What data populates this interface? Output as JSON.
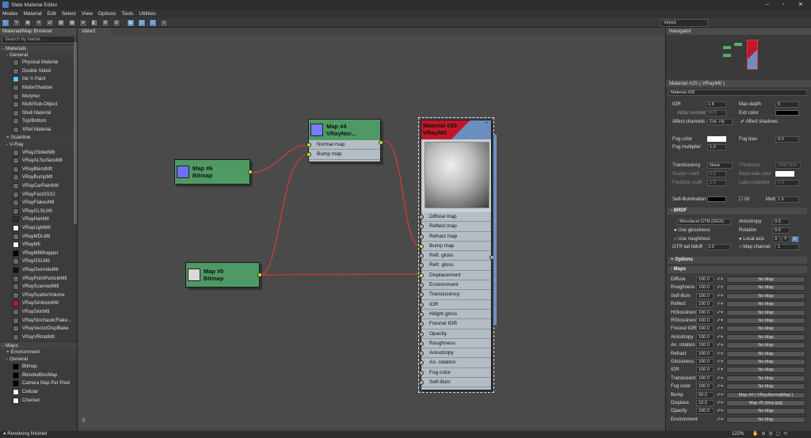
{
  "window": {
    "title": "Slate Material Editor"
  },
  "menu": [
    "Modes",
    "Material",
    "Edit",
    "Select",
    "View",
    "Options",
    "Tools",
    "Utilities"
  ],
  "toolbar": {
    "view_selector": "View1"
  },
  "browser": {
    "title": "Material/Map Browser",
    "search_placeholder": "Search by Name ...",
    "materials_label": "Materials",
    "general_label": "General",
    "general_items": [
      "Physical Material",
      "Double Sided",
      "Ink 'n Paint",
      "Matte/Shadow",
      "Morpher",
      "Multi/Sub-Object",
      "Shell Material",
      "Top/Bottom",
      "XRef Material"
    ],
    "scanline_label": "Scanline",
    "vray_label": "V-Ray",
    "vray_items": [
      "VRay2SidedMtl",
      "VRayALSurfaceMtl",
      "VRayBlendMtl",
      "VRayBumpMtl",
      "VRayCarPaintMtl",
      "VRayFastSSS2",
      "VRayFlakesMtl",
      "VRayGLSLMtl",
      "VRayHairMtl",
      "VRayLightMtl",
      "VRayMDLMtl",
      "VRayMtl",
      "VRayMtlWrapper",
      "VRayOSLMtl",
      "VRayOverrideMtl",
      "VRayPointParticleMtl",
      "VRayScannedMtl",
      "VRayScatterVolume",
      "VRaySimbiontMtl",
      "VRaySkinMtl",
      "VRayStochasticFlake...",
      "VRayVectorDisplBake",
      "VRayVRmatMtl"
    ],
    "maps_label": "Maps",
    "environment_label": "Environment",
    "maps_general_label": "General",
    "maps_items": [
      "Bitmap",
      "BlendedBoxMap",
      "Camera Map Per Pixel",
      "Cellular",
      "Checker"
    ]
  },
  "view": {
    "tab": "View1"
  },
  "nodes": {
    "map6": {
      "title1": "Map #6",
      "title2": "Bitmap"
    },
    "map5": {
      "title1": "Map #5",
      "title2": "Bitmap"
    },
    "map4": {
      "title1": "Map #4",
      "title2": "VRayNor...",
      "slots": [
        "Normal map",
        "Bump map"
      ]
    },
    "mat25": {
      "title1": "Material #25",
      "title2": "VRayMtl",
      "slots": [
        "Diffuse map",
        "Reflect map",
        "Refract map",
        "Bump map",
        "Refl. gloss",
        "Refr. gloss",
        "Displacement",
        "Environment",
        "Translucency",
        "IOR",
        "Hilight gloss",
        "Fresnel IOR",
        "Opacity",
        "Roughness",
        "Anisotropy",
        "An. rotation",
        "Fog color",
        "Self-illum"
      ]
    }
  },
  "navigator": {
    "title": "Navigator"
  },
  "props": {
    "title": "Material #25 ( VRayMtl )",
    "name_value": "Material #25",
    "ior_label": "IOR",
    "ior_value": "1.6",
    "max_depth_label": "Max depth",
    "max_depth_value": "5",
    "abbe_label": "Abbe number",
    "abbe_value": "50.0",
    "exit_color_label": "Exit color",
    "affect_channels_label": "Affect channels",
    "affect_channels_value": "Col. +fy",
    "affect_shadows_label": "Affect shadows",
    "fog_color_label": "Fog color",
    "fog_bias_label": "Fog bias",
    "fog_bias_value": "0.0",
    "fog_mult_label": "Fog multiplier",
    "fog_mult_value": "1.0",
    "translucency_label": "Translucency",
    "translucency_value": "None",
    "thickness_label": "Thickness",
    "thickness_value": "1000.0cm",
    "scatter_label": "Scatter coeff",
    "scatter_value": "0.0",
    "backside_label": "Back-side color",
    "fwdbck_label": "Fwd/bck coeff",
    "fwdbck_value": "1.0",
    "lightmult_label": "Light multiplier",
    "lightmult_value": "1.0",
    "selfillum_label": "Self-illumination",
    "gi_label": "GI",
    "mult_label": "Mult",
    "mult_value": "1.0",
    "brdf_label": "BRDF",
    "brdf_value": "Microfacet GTR (GGX)",
    "anisotropy_label": "Anisotropy",
    "anisotropy_value": "0.0",
    "use_gloss_label": "Use glossiness",
    "rotation_label": "Rotation",
    "rotation_value": "0.0",
    "use_rough_label": "Use roughness",
    "local_axis_label": "Local axis",
    "axis_x": "X",
    "axis_y": "Y",
    "axis_z": "Z",
    "gtr_label": "GTR tail falloff",
    "gtr_value": "2.0",
    "map_channel_label": "Map channel",
    "map_channel_value": "1",
    "options_label": "Options",
    "maps_label": "Maps",
    "maps": [
      {
        "name": "Diffuse",
        "value": "100.0",
        "map": "No Map"
      },
      {
        "name": "Roughness",
        "value": "100.0",
        "map": "No Map"
      },
      {
        "name": "Self-illum",
        "value": "100.0",
        "map": "No Map"
      },
      {
        "name": "Reflect",
        "value": "100.0",
        "map": "No Map"
      },
      {
        "name": "HGlossiness",
        "value": "100.0",
        "map": "No Map"
      },
      {
        "name": "RGlossiness",
        "value": "100.0",
        "map": "No Map"
      },
      {
        "name": "Fresnel IOR",
        "value": "100.0",
        "map": "No Map"
      },
      {
        "name": "Anisotropy",
        "value": "100.0",
        "map": "No Map"
      },
      {
        "name": "An. rotation",
        "value": "100.0",
        "map": "No Map"
      },
      {
        "name": "Refract",
        "value": "100.0",
        "map": "No Map"
      },
      {
        "name": "Glossiness",
        "value": "100.0",
        "map": "No Map"
      },
      {
        "name": "IOR",
        "value": "100.0",
        "map": "No Map"
      },
      {
        "name": "Translucent",
        "value": "100.0",
        "map": "No Map"
      },
      {
        "name": "Fog color",
        "value": "100.0",
        "map": "No Map"
      },
      {
        "name": "Bump",
        "value": "50.0",
        "map": "Map #4  ( VRayNormalMap )"
      },
      {
        "name": "Displace",
        "value": "10.0",
        "map": "Map #5 (disp.jpg)"
      },
      {
        "name": "Opacity",
        "value": "100.0",
        "map": "No Map"
      },
      {
        "name": "Environment",
        "value": "",
        "map": "No Map"
      }
    ]
  },
  "status": {
    "text": "Rendering finished",
    "zoom": "122%"
  },
  "colors": {
    "node_header": "#4f9a64",
    "node_body": "#b4bcc4",
    "wire": "#d23a3a",
    "socket": "#bfe03a",
    "material_header": "#c0182a",
    "accent": "#5a8fc8"
  }
}
